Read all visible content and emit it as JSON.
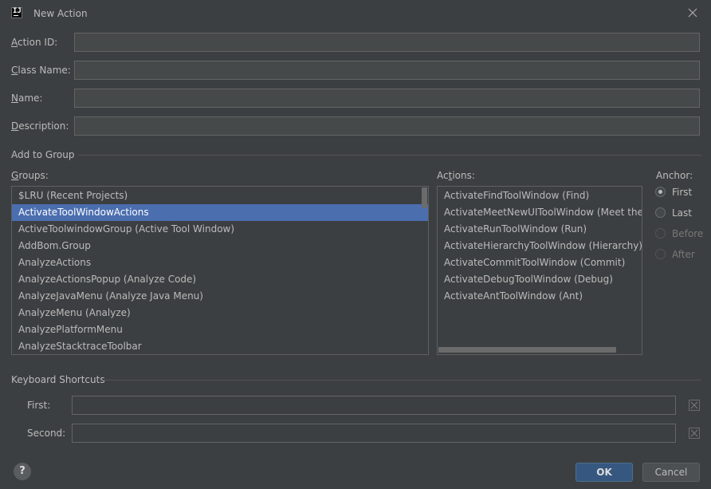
{
  "window": {
    "title": "New Action",
    "icon": "intellij-icon",
    "close_icon": "close-icon"
  },
  "form": {
    "action_id": {
      "label_u": "A",
      "label_rest": "ction ID:",
      "value": ""
    },
    "class_name": {
      "label_u": "C",
      "label_rest": "lass Name:",
      "value": ""
    },
    "name": {
      "label_u": "N",
      "label_rest": "ame:",
      "value": ""
    },
    "description": {
      "label_u": "D",
      "label_rest": "escription:",
      "value": ""
    }
  },
  "add_to_group": {
    "title": "Add to Group",
    "groups_label_u": "G",
    "groups_label_rest": "roups:",
    "groups": [
      "$LRU (Recent Projects)",
      "ActivateToolWindowActions",
      "ActiveToolwindowGroup (Active Tool Window)",
      "AddBom.Group",
      "AnalyzeActions",
      "AnalyzeActionsPopup (Analyze Code)",
      "AnalyzeJavaMenu (Analyze Java Menu)",
      "AnalyzeMenu (Analyze)",
      "AnalyzePlatformMenu",
      "AnalyzeStacktraceToolbar"
    ],
    "selected_group": "ActivateToolWindowActions",
    "actions_label_pre": "Ac",
    "actions_label_u": "t",
    "actions_label_rest": "ions:",
    "actions": [
      "ActivateFindToolWindow (Find)",
      "ActivateMeetNewUIToolWindow (Meet the Ne",
      "ActivateRunToolWindow (Run)",
      "ActivateHierarchyToolWindow (Hierarchy)",
      "ActivateCommitToolWindow (Commit)",
      "ActivateDebugToolWindow (Debug)",
      "ActivateAntToolWindow (Ant)"
    ],
    "anchor_label": "Anchor:",
    "anchors": [
      {
        "label": "First",
        "checked": true,
        "enabled": true
      },
      {
        "label": "Last",
        "checked": false,
        "enabled": true
      },
      {
        "label": "Before",
        "checked": false,
        "enabled": false
      },
      {
        "label": "After",
        "checked": false,
        "enabled": false
      }
    ]
  },
  "shortcuts": {
    "title": "Keyboard Shortcuts",
    "first_label": "First:",
    "first_value": "",
    "second_label": "Second:",
    "second_value": ""
  },
  "footer": {
    "help_label": "?",
    "ok_label": "OK",
    "cancel_label": "Cancel"
  },
  "colors": {
    "background": "#3c3f41",
    "selection": "#4b6eaf",
    "primary_button": "#365880"
  }
}
